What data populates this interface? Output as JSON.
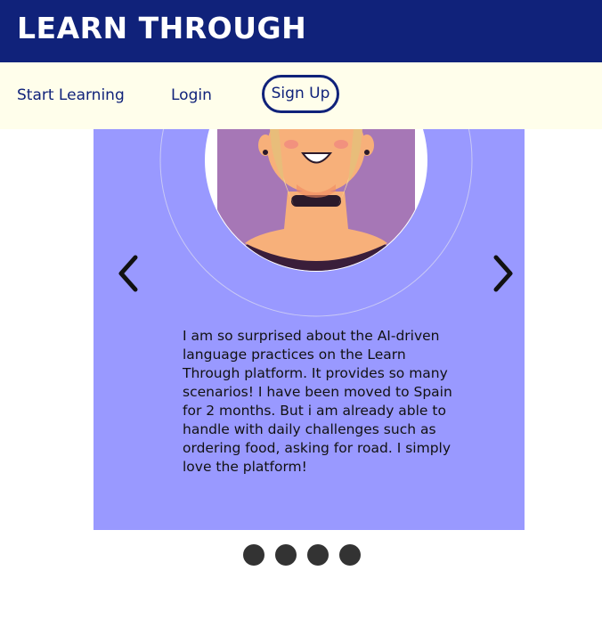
{
  "header": {
    "brand": "LEARN THROUGH"
  },
  "nav": {
    "start_learning": "Start Learning",
    "login": "Login",
    "sign_up": "Sign Up"
  },
  "testimonial": {
    "quote": "I am so surprised about the AI-driven language practices on the Learn Through platform. It provides so many scenarios! I have been moved to Spain for 2 months. But i am already able to handle with daily challenges such as ordering food, asking for road. I simply love the platform!",
    "prev_icon": "chevron-left-icon",
    "next_icon": "chevron-right-icon"
  },
  "carousel": {
    "slide_count": 4
  },
  "colors": {
    "header_bg": "#10227a",
    "nav_bg": "#fffeeb",
    "card_bg": "#9999ff",
    "dot": "#333333"
  }
}
